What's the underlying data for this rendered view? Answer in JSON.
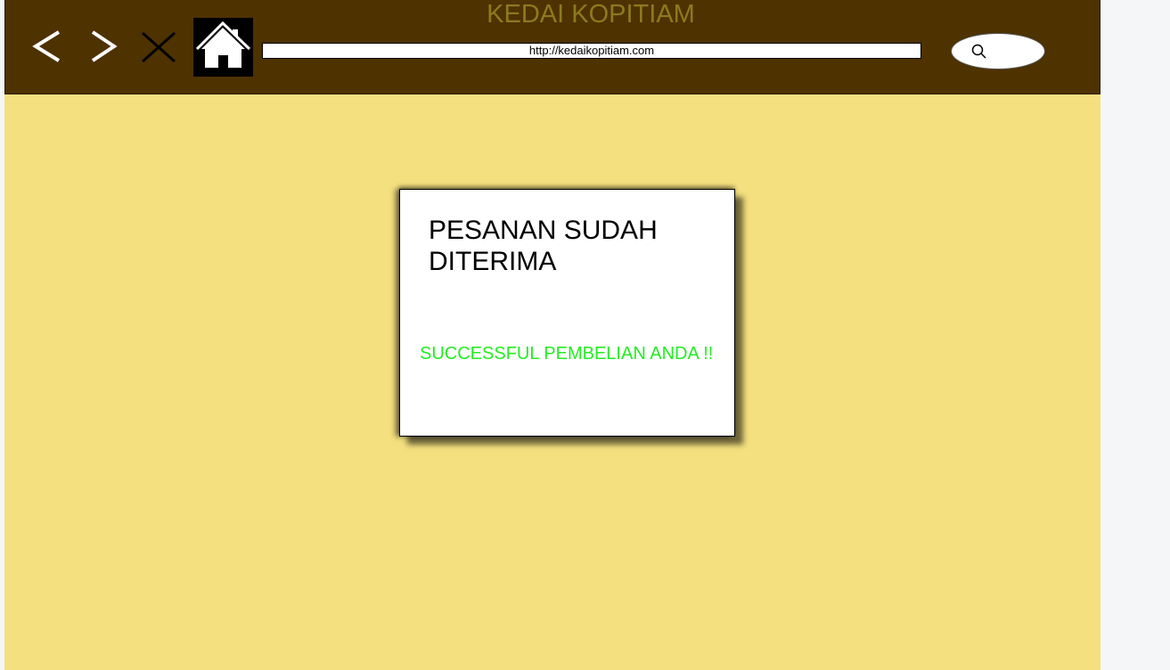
{
  "header": {
    "title": "KEDAI KOPITIAM",
    "address_value": "http://kedaikopitiam.com"
  },
  "nav": {
    "back_icon": "chevron-left-icon",
    "forward_icon": "chevron-right-icon",
    "close_icon": "close-icon",
    "home_icon": "home-icon",
    "search_icon": "search-icon"
  },
  "dialog": {
    "title": "PESANAN SUDAH DITERIMA",
    "message": "SUCCESSFUL PEMBELIAN ANDA !!"
  },
  "colors": {
    "header_bg": "#4e3200",
    "title_color": "#8c7a1e",
    "page_bg": "#f4e07f",
    "success_text": "#22ee22"
  }
}
